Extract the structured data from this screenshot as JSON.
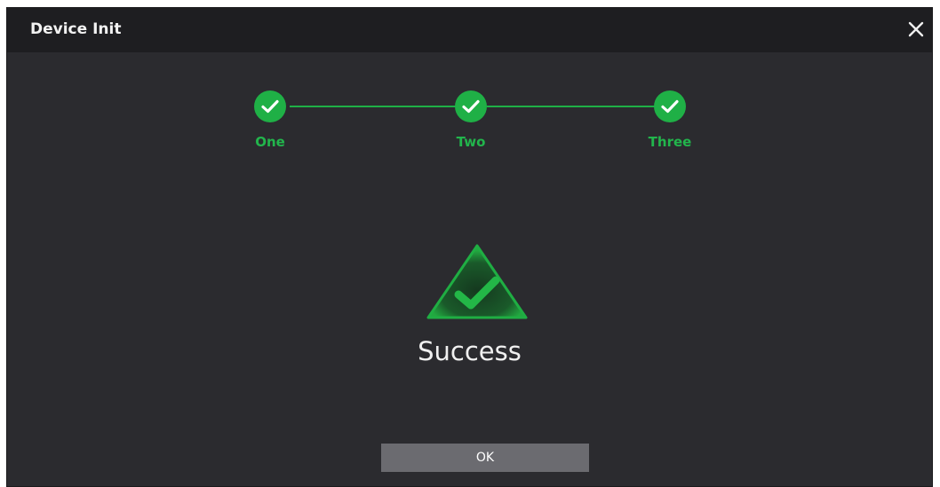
{
  "dialog": {
    "title": "Device Init",
    "close_icon": "close-icon"
  },
  "steps": [
    {
      "label": "One",
      "status": "complete",
      "icon": "check-icon"
    },
    {
      "label": "Two",
      "status": "complete",
      "icon": "check-icon"
    },
    {
      "label": "Three",
      "status": "complete",
      "icon": "check-icon"
    }
  ],
  "result": {
    "icon": "success-triangle-check-icon",
    "message": "Success"
  },
  "actions": {
    "ok_label": "OK"
  },
  "colors": {
    "accent": "#1fb046",
    "background": "#2b2b2f",
    "titlebar": "#1e1e21",
    "button": "#6b6b70"
  }
}
